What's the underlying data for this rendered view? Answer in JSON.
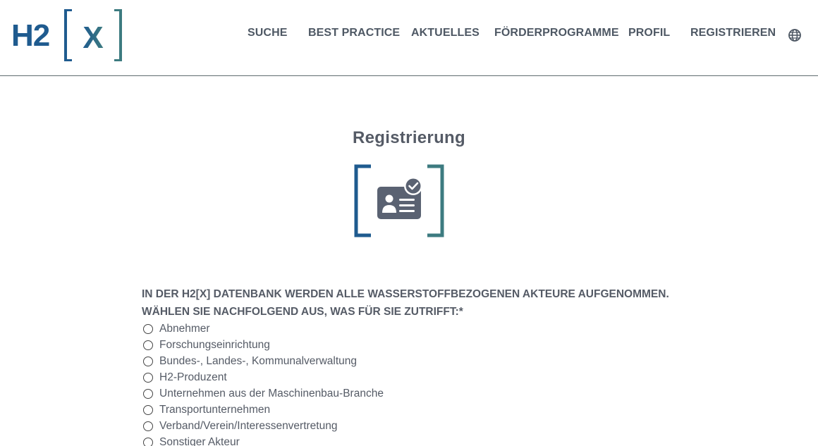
{
  "header": {
    "logo": {
      "prefix": "H2",
      "bracket_letter": "X"
    },
    "nav": [
      {
        "label": "SUCHE"
      },
      {
        "label": "BEST PRACTICE"
      },
      {
        "label": "AKTUELLES"
      },
      {
        "label": "FÖRDERPROGRAMME"
      },
      {
        "label": "PROFIL"
      },
      {
        "label": "REGISTRIEREN"
      }
    ],
    "language_icon": "globe-icon"
  },
  "main": {
    "title": "Registrierung",
    "icon": "id-card-check-icon",
    "question_line1": "IN DER H2[X] DATENBANK WERDEN ALLE WASSERSTOFFBEZOGENEN AKTEURE AUFGENOMMEN.",
    "question_line2": "WÄHLEN SIE NACHFOLGEND AUS, WAS FÜR SIE ZUTRIFFT:*",
    "options": [
      {
        "label": "Abnehmer"
      },
      {
        "label": "Forschungseinrichtung"
      },
      {
        "label": "Bundes-, Landes-, Kommunalverwaltung"
      },
      {
        "label": "H2-Produzent"
      },
      {
        "label": "Unternehmen aus der Maschinenbau-Branche"
      },
      {
        "label": "Transportunternehmen"
      },
      {
        "label": "Verband/Verein/Interessenvertretung"
      },
      {
        "label": "Sonstiger Akteur"
      }
    ]
  },
  "colors": {
    "brand_blue": "#1f5b8f",
    "brand_teal": "#3d7b80",
    "text_gray": "#555b66",
    "icon_gray": "#5a6272"
  }
}
